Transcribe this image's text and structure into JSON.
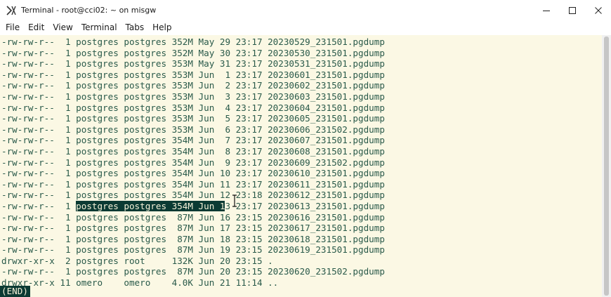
{
  "window": {
    "title": "Terminal - root@cci02: ~ on misgw",
    "controls": [
      "minimize",
      "maximize",
      "close"
    ]
  },
  "menu": [
    {
      "label": "File"
    },
    {
      "label": "Edit"
    },
    {
      "label": "View"
    },
    {
      "label": "Terminal"
    },
    {
      "label": "Tabs"
    },
    {
      "label": "Help"
    }
  ],
  "terminal": {
    "lines": [
      {
        "pre": "-rw-rw-r--  1 postgres postgres 352M May 29 23:17 20230529_231501.pgdump",
        "sel": "",
        "post": ""
      },
      {
        "pre": "-rw-rw-r--  1 postgres postgres 352M May 30 23:17 20230530_231501.pgdump",
        "sel": "",
        "post": ""
      },
      {
        "pre": "-rw-rw-r--  1 postgres postgres 353M May 31 23:17 20230531_231501.pgdump",
        "sel": "",
        "post": ""
      },
      {
        "pre": "-rw-rw-r--  1 postgres postgres 353M Jun  1 23:17 20230601_231501.pgdump",
        "sel": "",
        "post": ""
      },
      {
        "pre": "-rw-rw-r--  1 postgres postgres 353M Jun  2 23:17 20230602_231501.pgdump",
        "sel": "",
        "post": ""
      },
      {
        "pre": "-rw-rw-r--  1 postgres postgres 353M Jun  3 23:17 20230603_231501.pgdump",
        "sel": "",
        "post": ""
      },
      {
        "pre": "-rw-rw-r--  1 postgres postgres 353M Jun  4 23:17 20230604_231501.pgdump",
        "sel": "",
        "post": ""
      },
      {
        "pre": "-rw-rw-r--  1 postgres postgres 353M Jun  5 23:17 20230605_231501.pgdump",
        "sel": "",
        "post": ""
      },
      {
        "pre": "-rw-rw-r--  1 postgres postgres 353M Jun  6 23:17 20230606_231502.pgdump",
        "sel": "",
        "post": ""
      },
      {
        "pre": "-rw-rw-r--  1 postgres postgres 354M Jun  7 23:17 20230607_231501.pgdump",
        "sel": "",
        "post": ""
      },
      {
        "pre": "-rw-rw-r--  1 postgres postgres 354M Jun  8 23:17 20230608_231501.pgdump",
        "sel": "",
        "post": ""
      },
      {
        "pre": "-rw-rw-r--  1 postgres postgres 354M Jun  9 23:17 20230609_231502.pgdump",
        "sel": "",
        "post": ""
      },
      {
        "pre": "-rw-rw-r--  1 postgres postgres 354M Jun 10 23:17 20230610_231501.pgdump",
        "sel": "",
        "post": ""
      },
      {
        "pre": "-rw-rw-r--  1 postgres postgres 354M Jun 11 23:17 20230611_231501.pgdump",
        "sel": "",
        "post": ""
      },
      {
        "pre": "-rw-rw-r--  1 postgres postgres 354M Jun 12 23:18 20230612_231501.pgdump",
        "sel": "",
        "post": ""
      },
      {
        "pre": "-rw-rw-r--  1 ",
        "sel": "postgres postgres 354M Jun 1",
        "post": "3 23:17 20230613_231501.pgdump"
      },
      {
        "pre": "-rw-rw-r--  1 postgres postgres  87M Jun 16 23:15 20230616_231501.pgdump",
        "sel": "",
        "post": ""
      },
      {
        "pre": "-rw-rw-r--  1 postgres postgres  87M Jun 17 23:15 20230617_231501.pgdump",
        "sel": "",
        "post": ""
      },
      {
        "pre": "-rw-rw-r--  1 postgres postgres  87M Jun 18 23:15 20230618_231501.pgdump",
        "sel": "",
        "post": ""
      },
      {
        "pre": "-rw-rw-r--  1 postgres postgres  87M Jun 19 23:15 20230619_231501.pgdump",
        "sel": "",
        "post": ""
      },
      {
        "pre": "drwxr-xr-x  2 postgres root     132K Jun 20 23:15 .",
        "sel": "",
        "post": ""
      },
      {
        "pre": "-rw-rw-r--  1 postgres postgres  87M Jun 20 23:15 20230620_231502.pgdump",
        "sel": "",
        "post": ""
      },
      {
        "pre": "drwxr-xr-x 11 omero    omero    4.0K Jun 21 11:14 ..",
        "sel": "",
        "post": ""
      }
    ],
    "status": "(END)"
  },
  "colors": {
    "terminal_bg": "#fbf8e4",
    "terminal_fg": "#2a5a4a",
    "selection_bg": "#0b3a33",
    "selection_fg": "#f4f1d8"
  },
  "icons": {
    "app": "terminal-x-icon",
    "cursor": "ibeam-cursor-icon"
  }
}
